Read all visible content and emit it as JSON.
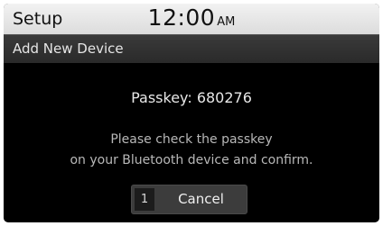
{
  "status_bar": {
    "app_title": "Setup",
    "time": "12:00",
    "ampm": "AM"
  },
  "header": {
    "title": "Add New Device"
  },
  "dialog": {
    "passkey_text": "Passkey: 680276",
    "message_line1": "Please check the passkey",
    "message_line2": "on your Bluetooth device and confirm.",
    "cancel": {
      "hotkey": "1",
      "label": "Cancel"
    }
  },
  "colors": {
    "background": "#000000",
    "status_bar": "#e6e6e6",
    "subheader": "#333333",
    "button": "#3c3c3c",
    "passkey_text": "#e8e8e8",
    "message_text": "#b8b8b8"
  }
}
